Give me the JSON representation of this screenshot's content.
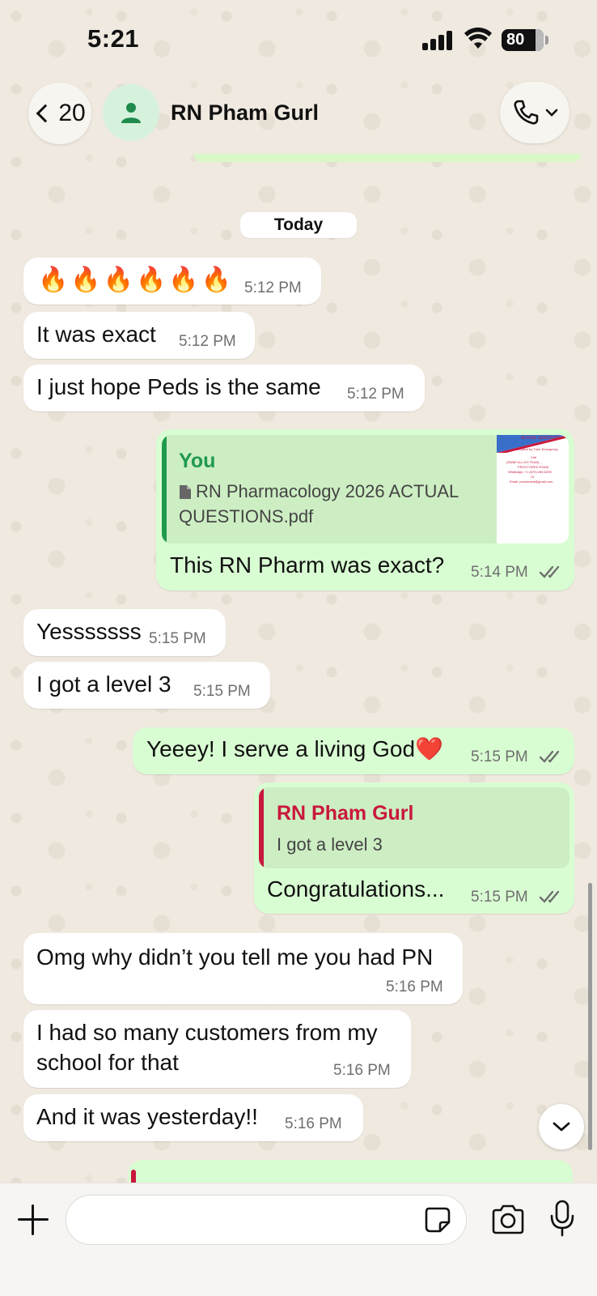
{
  "status_bar": {
    "time": "5:21",
    "battery": "80"
  },
  "header": {
    "back_count": "20",
    "contact_name": "RN Pham Gurl",
    "icons": {
      "back": "chevron-left-icon",
      "avatar": "person-icon",
      "call": "phone-icon"
    }
  },
  "date_chip": "Today",
  "messages": [
    {
      "id": "m1",
      "direction": "incoming",
      "text": "🔥🔥🔥🔥🔥🔥",
      "time": "5:12 PM"
    },
    {
      "id": "m2",
      "direction": "incoming",
      "text": "It was exact",
      "time": "5:12 PM"
    },
    {
      "id": "m3",
      "direction": "incoming",
      "text": "I just hope Peds is the same",
      "time": "5:12 PM"
    },
    {
      "id": "m4",
      "direction": "outgoing",
      "quote": {
        "author": "You",
        "file_line1": "RN Pharmacology 2026 ACTUAL",
        "file_line2": "QUESTIONS.pdf",
        "thumb_lines": [
          "ACTUAL QUESTIONS",
          "Compiled by Tutor Emergency",
          "Call",
          "(SWAP ALL ATI TEAS)...",
          "PROCTORED EXAM",
          "WhatsApp: +1 (570) 269-5259",
          "Or",
          "Email: proctortest@gmail.com"
        ]
      },
      "text": "This RN Pharm was exact?",
      "time": "5:14 PM",
      "read": true
    },
    {
      "id": "m5",
      "direction": "incoming",
      "text": "Yesssssss",
      "time": "5:15 PM"
    },
    {
      "id": "m6",
      "direction": "incoming",
      "text": "I got a level 3",
      "time": "5:15 PM"
    },
    {
      "id": "m7",
      "direction": "outgoing",
      "text": "Yeeey! I serve a living God❤️",
      "time": "5:15 PM",
      "read": true
    },
    {
      "id": "m8",
      "direction": "outgoing",
      "quote": {
        "author": "RN Pham Gurl",
        "text": "I got a level 3"
      },
      "text": "Congratulations...",
      "time": "5:15 PM",
      "read": true
    },
    {
      "id": "m9",
      "direction": "incoming",
      "text": "Omg why didn’t you tell me you had PN",
      "time": "5:16 PM"
    },
    {
      "id": "m10",
      "direction": "incoming",
      "line1": "I had so many customers from my",
      "line2": "school for that",
      "time": "5:16 PM"
    },
    {
      "id": "m11",
      "direction": "incoming",
      "text": "And it was yesterday!!",
      "time": "5:16 PM"
    }
  ],
  "composer": {
    "input_value": "",
    "icons": {
      "attach": "plus-icon",
      "sticker": "sticker-icon",
      "camera": "camera-icon",
      "mic": "microphone-icon"
    }
  },
  "colors": {
    "outgoing_bubble": "#d9fdd3",
    "incoming_bubble": "#ffffff",
    "you_accent": "#1f9a4c",
    "contact_accent": "#c8183d",
    "chat_background": "#efe9e0"
  }
}
